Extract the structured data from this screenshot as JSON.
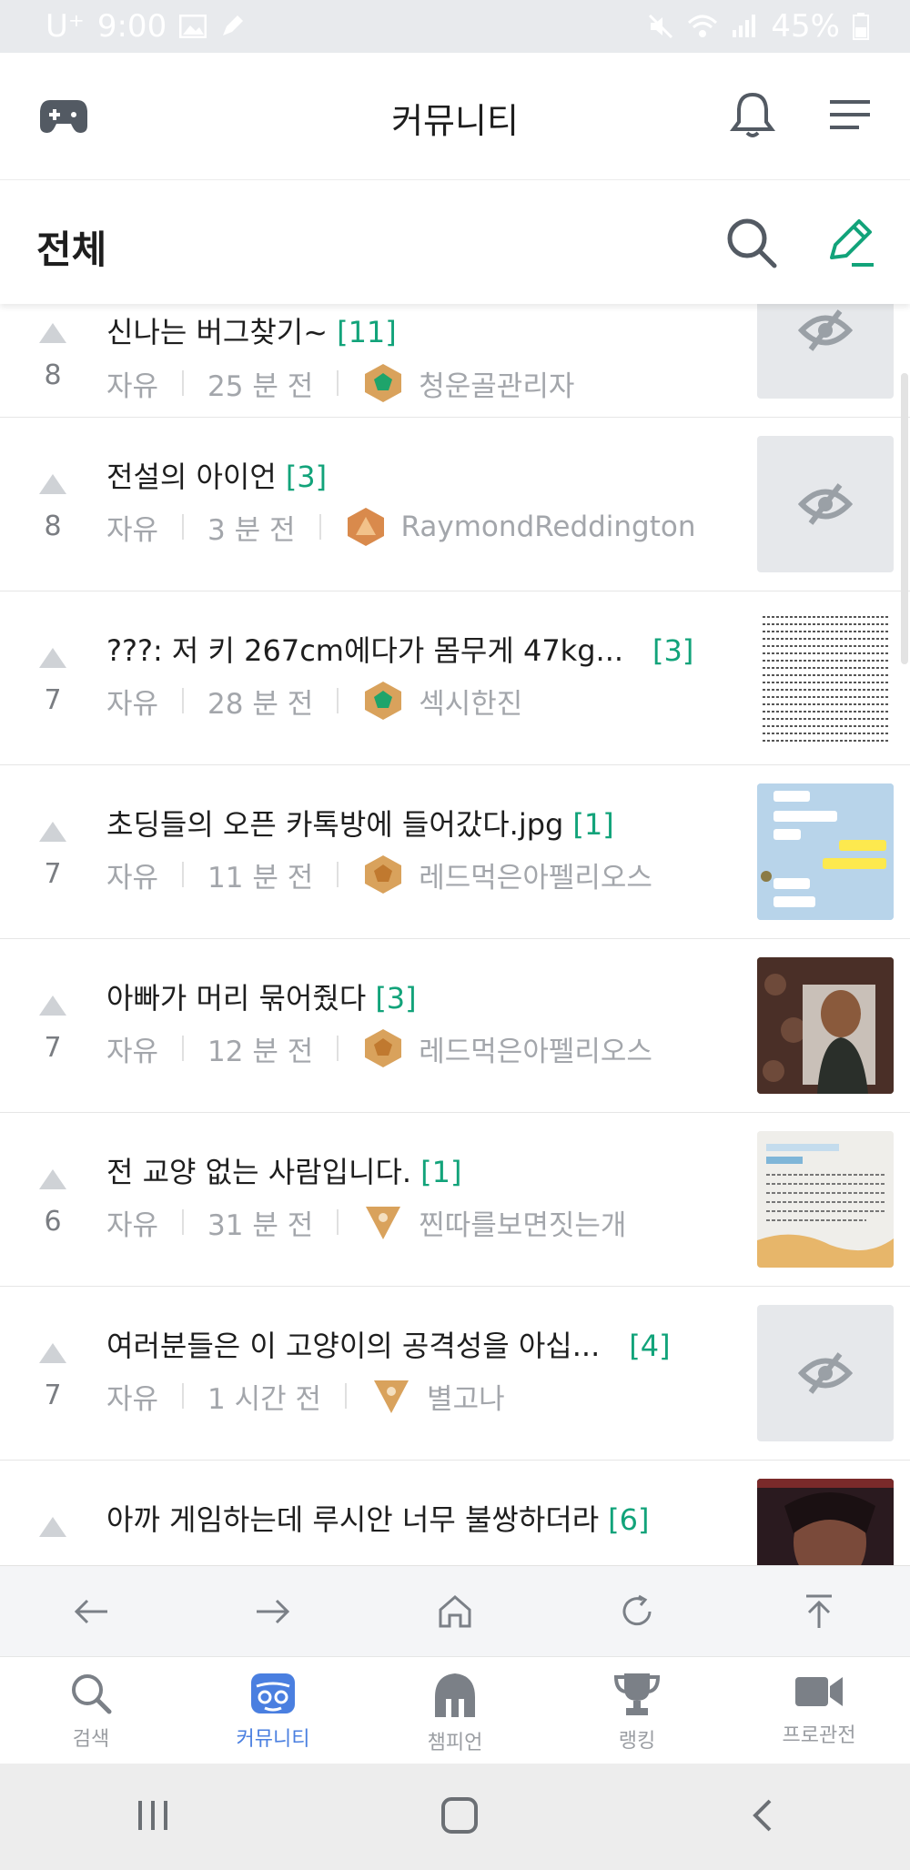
{
  "status_bar": {
    "carrier": "U⁺",
    "time": "9:00",
    "battery": "45%"
  },
  "header": {
    "title": "커뮤니티"
  },
  "sub_header": {
    "title": "전체"
  },
  "colors": {
    "accent": "#12a37a",
    "active_tab": "#4a7fe0",
    "badge_gold": "#d9a25c"
  },
  "posts": [
    {
      "votes": "8",
      "title": "신나는 버그찾기~",
      "comments": "[11]",
      "category": "자유",
      "time": "25 분 전",
      "author": "청운골관리자",
      "badge": "pentagon-emerald",
      "thumb": "hidden"
    },
    {
      "votes": "8",
      "title": "전설의 아이언",
      "comments": "[3]",
      "category": "자유",
      "time": "3 분 전",
      "author": "RaymondReddington",
      "badge": "hexagon-orange",
      "thumb": "hidden"
    },
    {
      "votes": "7",
      "title": "???: 저 키 267cm에다가 몸무게 47kg...",
      "comments": "[3]",
      "category": "자유",
      "time": "28 분 전",
      "author": "섹시한진",
      "badge": "pentagon-emerald",
      "thumb": "text"
    },
    {
      "votes": "7",
      "title": "초딩들의 오픈 카톡방에 들어갔다.jpg",
      "comments": "[1]",
      "category": "자유",
      "time": "11 분 전",
      "author": "레드먹은아펠리오스",
      "badge": "pentagon-gold",
      "thumb": "chat"
    },
    {
      "votes": "7",
      "title": "아빠가 머리 묶어줬다",
      "comments": "[3]",
      "category": "자유",
      "time": "12 분 전",
      "author": "레드먹은아펠리오스",
      "badge": "pentagon-gold",
      "thumb": "photo"
    },
    {
      "votes": "6",
      "title": "전 교양 없는 사람입니다.",
      "comments": "[1]",
      "category": "자유",
      "time": "31 분 전",
      "author": "찐따를보면짓는개",
      "badge": "triangle-gold",
      "thumb": "paper"
    },
    {
      "votes": "7",
      "title": "여러분들은 이 고양이의 공격성을 아십...",
      "comments": "[4]",
      "category": "자유",
      "time": "1 시간 전",
      "author": "별고나",
      "badge": "triangle-gold",
      "thumb": "hidden"
    },
    {
      "votes": "",
      "title": "아까 게임하는데 루시안 너무 불쌍하더라",
      "comments": "[6]",
      "category": "",
      "time": "",
      "author": "",
      "badge": "",
      "thumb": "game"
    }
  ],
  "tabs": [
    {
      "label": "검색",
      "icon": "search-icon"
    },
    {
      "label": "커뮤니티",
      "icon": "community-icon"
    },
    {
      "label": "챔피언",
      "icon": "helmet-icon"
    },
    {
      "label": "랭킹",
      "icon": "trophy-icon"
    },
    {
      "label": "프로관전",
      "icon": "video-icon"
    }
  ]
}
